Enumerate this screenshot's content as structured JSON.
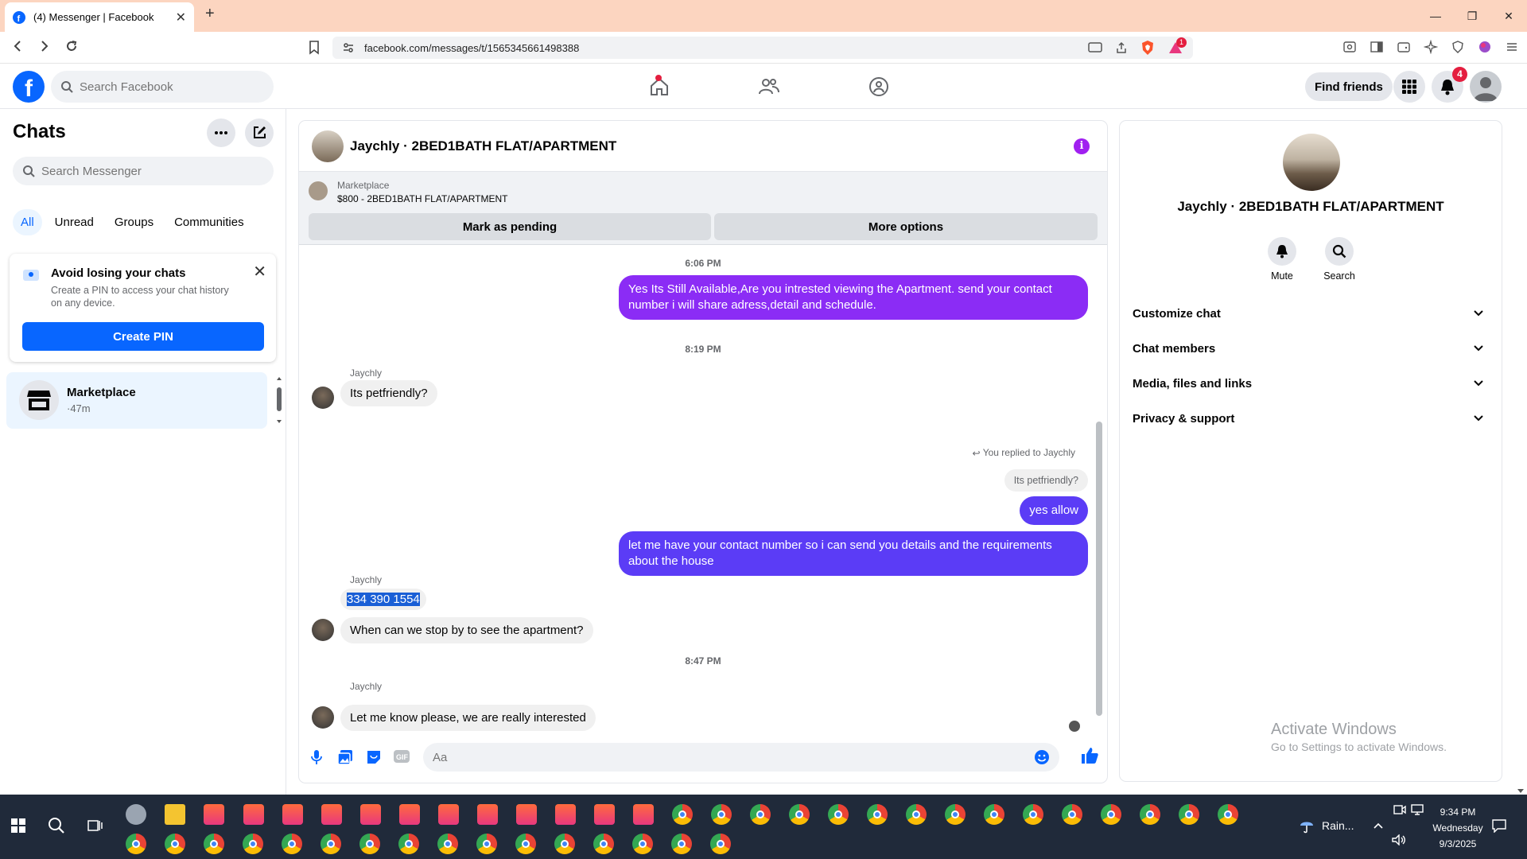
{
  "browser": {
    "tab_title": "(4) Messenger | Facebook",
    "new_tab": "+",
    "url": "facebook.com/messages/t/1565345661498388",
    "brave_badge": "1"
  },
  "fb_header": {
    "search_placeholder": "Search Facebook",
    "find_friends": "Find friends",
    "notification_count": "4"
  },
  "left_panel": {
    "title": "Chats",
    "search_placeholder": "Search Messenger",
    "filters": [
      "All",
      "Unread",
      "Groups",
      "Communities"
    ],
    "active_filter": "All",
    "pin_card": {
      "heading": "Avoid losing your chats",
      "description": "Create a PIN to access your chat history on any device.",
      "button": "Create PIN"
    },
    "conversations": [
      {
        "name": "Marketplace",
        "time": "·47m"
      }
    ]
  },
  "chat": {
    "title": "Jaychly · 2BED1BATH FLAT/APARTMENT",
    "marketplace_label": "Marketplace",
    "listing": "$800 - 2BED1BATH FLAT/APARTMENT",
    "mark_pending": "Mark as pending",
    "more_options": "More options",
    "messages": {
      "ts1": "6:06 PM",
      "out1": "Yes Its Still Available,Are you intrested viewing the Apartment. send your contact number i will share adress,detail and schedule.",
      "ts2": "8:19 PM",
      "sender1": "Jaychly",
      "in1": "Its petfriendly?",
      "reply_header": "You replied to Jaychly",
      "reply_quote": "Its petfriendly?",
      "out2": "yes allow",
      "out3": "let me have your contact number so i can send you details and the requirements about the house",
      "sender2": "Jaychly",
      "in2": "334 390 1554",
      "in3": "When can we stop by to see the apartment?",
      "ts3": "8:47 PM",
      "sender3": "Jaychly",
      "in4": "Let me know please, we are really interested"
    },
    "composer_placeholder": "Aa"
  },
  "right_panel": {
    "name": "Jaychly · 2BED1BATH FLAT/APARTMENT",
    "mute": "Mute",
    "search": "Search",
    "sections": [
      "Customize chat",
      "Chat members",
      "Media, files and links",
      "Privacy & support"
    ]
  },
  "watermark": {
    "line1": "Activate Windows",
    "line2": "Go to Settings to activate Windows."
  },
  "taskbar": {
    "weather": "Rain...",
    "time": "9:34 PM",
    "day": "Wednesday",
    "date": "9/3/2025"
  },
  "colors": {
    "fb_blue": "#0866ff",
    "outgoing_bubble": "#8b2cf5",
    "outgoing_bubble_2": "#5b3cf6",
    "tab_strip": "#fcd5c0",
    "taskbar": "#202a3a"
  }
}
